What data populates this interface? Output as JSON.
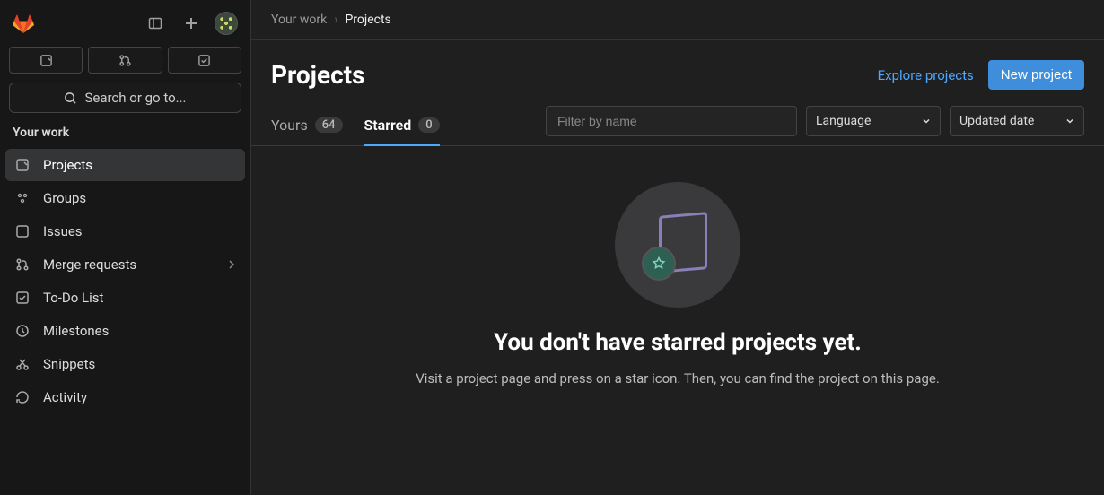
{
  "sidebar": {
    "search_label": "Search or go to...",
    "section_label": "Your work",
    "items": [
      {
        "label": "Projects",
        "icon": "project-icon",
        "active": true
      },
      {
        "label": "Groups",
        "icon": "groups-icon"
      },
      {
        "label": "Issues",
        "icon": "issues-icon"
      },
      {
        "label": "Merge requests",
        "icon": "merge-icon",
        "expandable": true
      },
      {
        "label": "To-Do List",
        "icon": "todo-icon"
      },
      {
        "label": "Milestones",
        "icon": "clock-icon"
      },
      {
        "label": "Snippets",
        "icon": "snippets-icon"
      },
      {
        "label": "Activity",
        "icon": "activity-icon"
      }
    ]
  },
  "breadcrumb": {
    "parent": "Your work",
    "current": "Projects"
  },
  "header": {
    "title": "Projects",
    "explore_link": "Explore projects",
    "new_button": "New project"
  },
  "tabs": [
    {
      "label": "Yours",
      "count": "64",
      "active": false
    },
    {
      "label": "Starred",
      "count": "0",
      "active": true
    }
  ],
  "filters": {
    "name_placeholder": "Filter by name",
    "language_label": "Language",
    "sort_label": "Updated date"
  },
  "empty_state": {
    "title": "You don't have starred projects yet.",
    "description": "Visit a project page and press on a star icon. Then, you can find the project on this page."
  }
}
